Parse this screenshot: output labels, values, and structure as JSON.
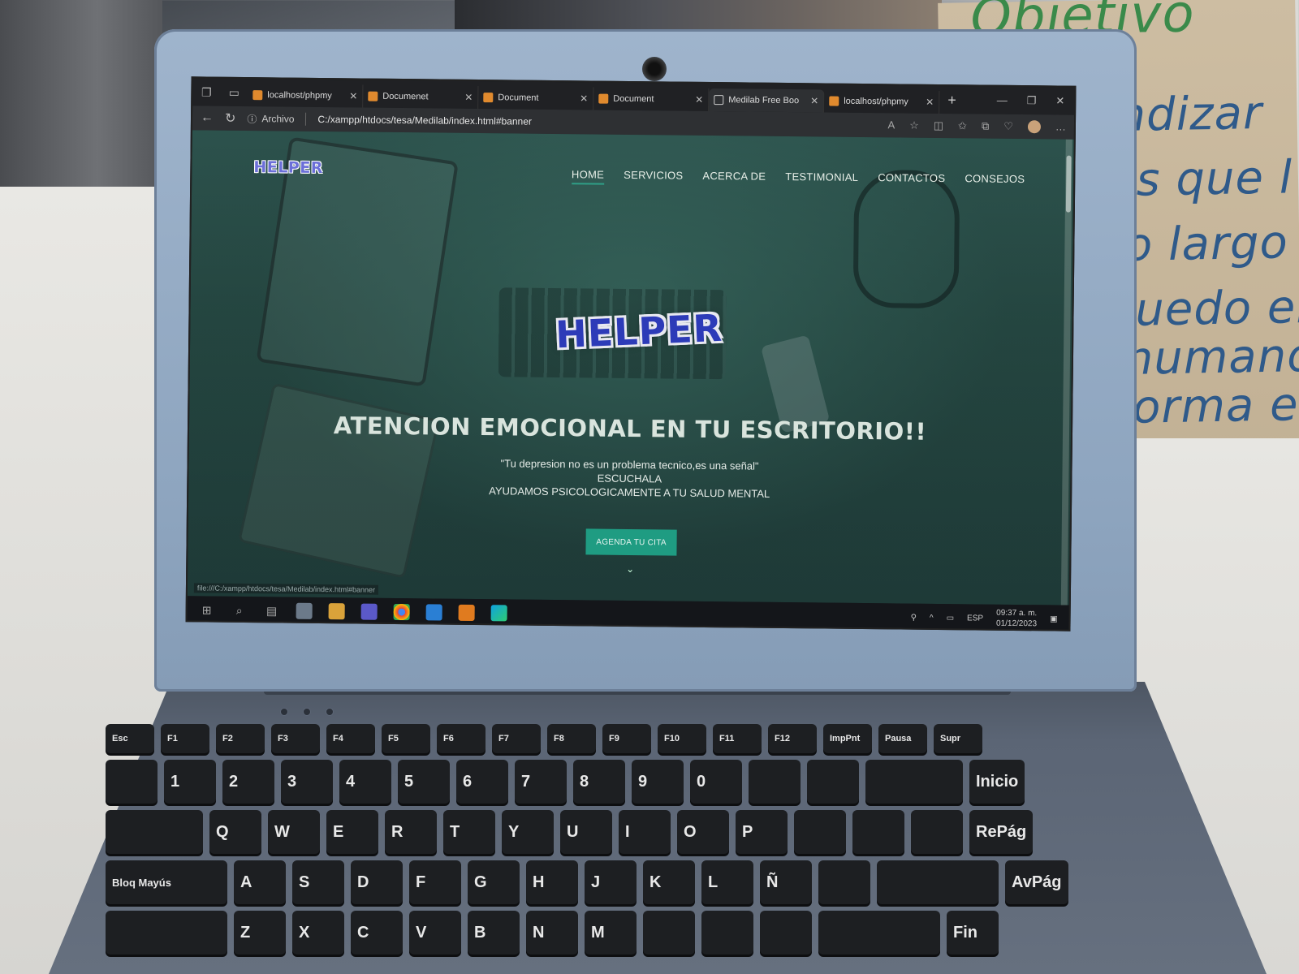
{
  "browser": {
    "tabs": [
      {
        "label": "localhost/phpmy",
        "icon": "app-icon"
      },
      {
        "label": "Documenet",
        "icon": "app-icon"
      },
      {
        "label": "Document",
        "icon": "app-icon"
      },
      {
        "label": "Document",
        "icon": "app-icon"
      },
      {
        "label": "Medilab Free Boo",
        "icon": "page-icon"
      },
      {
        "label": "localhost/phpmy",
        "icon": "app-icon"
      }
    ],
    "address": {
      "scheme_label": "Archivo",
      "url": "C:/xampp/htdocs/tesa/Medilab/index.html#banner"
    }
  },
  "site": {
    "logo_small": "HELPER",
    "nav": [
      "HOME",
      "SERVICIOS",
      "ACERCA DE",
      "TESTIMONIAL",
      "CONTACTOS",
      "CONSEJOS"
    ],
    "logo_big": "HELPER",
    "headline": "ATENCION EMOCIONAL EN TU ESCRITORIO!!",
    "sub_lines": [
      "\"Tu depresion no es un problema tecnico,es una señal\"",
      "ESCUCHALA",
      "AYUDAMOS PSICOLOGICAMENTE A TU SALUD MENTAL"
    ],
    "cta": "AGENDA TU CITA",
    "status_url": "file:///C:/xampp/htdocs/tesa/Medilab/index.html#banner",
    "accent_color": "#1f9c82"
  },
  "taskbar": {
    "lang": "ESP",
    "time": "09:37 a. m.",
    "date": "01/12/2023"
  },
  "sign": {
    "lines": [
      "Objetivo",
      "ndizar",
      "es que l",
      "lo largo",
      "quedo en",
      "humano,",
      "Forma en"
    ]
  },
  "keyboard": {
    "fn_row": [
      "Esc",
      "F1",
      "F2",
      "F3",
      "F4",
      "F5",
      "F6",
      "F7",
      "F8",
      "F9",
      "F10",
      "F11",
      "F12",
      "ImpPnt",
      "Pausa",
      "Supr"
    ],
    "num_row": [
      "1",
      "2",
      "3",
      "4",
      "5",
      "6",
      "7",
      "8",
      "9",
      "0"
    ],
    "q_row": [
      "Q",
      "W",
      "E",
      "R",
      "T",
      "Y",
      "U",
      "I",
      "O",
      "P"
    ],
    "a_row": [
      "A",
      "S",
      "D",
      "F",
      "G",
      "H",
      "J",
      "K",
      "L",
      "Ñ"
    ],
    "z_row": [
      "Z",
      "X",
      "C",
      "V",
      "B",
      "N",
      "M"
    ],
    "labels": {
      "tab_key": "",
      "caps": "Bloq Mayús",
      "inicio": "Inicio",
      "repag": "RePág",
      "avpag": "AvPág",
      "fin": "Fin"
    }
  }
}
